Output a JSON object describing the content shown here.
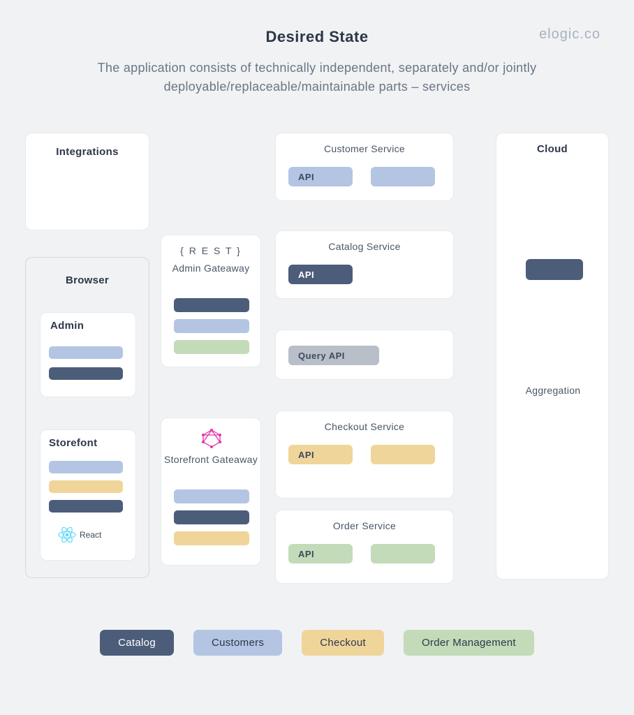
{
  "header": {
    "title": "Desired State",
    "brand": "elogic.co",
    "subtitle": "The application consists of technically independent, separately and/or jointly deployable/replaceable/maintainable parts – services"
  },
  "left": {
    "integrations": "Integrations",
    "browser": "Browser",
    "admin": "Admin",
    "storefront": "Storefont",
    "react": "React"
  },
  "gateways": {
    "rest": "{ R E S T }",
    "admin_gateway": "Admin Gateaway",
    "storefront_gateway": "Storefront Gateaway"
  },
  "services": {
    "customer": "Customer Service",
    "catalog": "Catalog Service",
    "checkout": "Checkout Service",
    "order": "Order Service",
    "query_api": "Query API",
    "api": "API"
  },
  "cloud": {
    "title": "Cloud",
    "aggregation": "Aggregation"
  },
  "legend": {
    "catalog": "Catalog",
    "customers": "Customers",
    "checkout": "Checkout",
    "order_mgmt": "Order Management"
  },
  "colors": {
    "catalog": "#4c5d7a",
    "customers": "#b3c5e3",
    "checkout": "#f0d59a",
    "order": "#c3dbb9",
    "gray": "#b8bfc9",
    "arrow_dark": "#4a5568",
    "arrow_orange": "#f57c4a"
  }
}
